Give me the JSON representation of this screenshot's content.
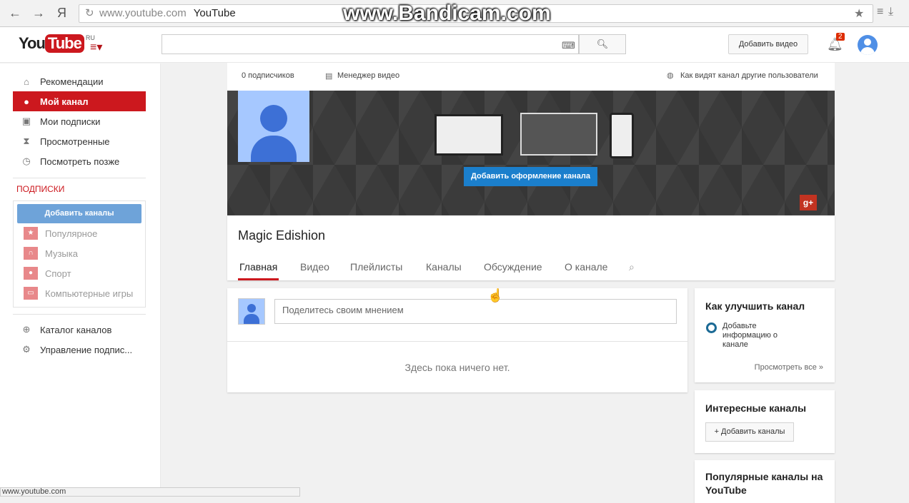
{
  "browser": {
    "back": "←",
    "forward": "→",
    "yandex": "Я",
    "url_host": "www.youtube.com",
    "url_title": "YouTube",
    "star": "★",
    "watermark": "www.Bandicam.com",
    "status": "www.youtube.com"
  },
  "header": {
    "logo_you": "You",
    "logo_tube": "Tube",
    "logo_region": "RU",
    "upload": "Добавить видео",
    "notifications": "2"
  },
  "sidebar": {
    "items": [
      {
        "label": "Рекомендации",
        "icon": "home-icon"
      },
      {
        "label": "Мой канал",
        "icon": "user-icon"
      },
      {
        "label": "Мои подписки",
        "icon": "subscriptions-icon"
      },
      {
        "label": "Просмотренные",
        "icon": "hourglass-icon"
      },
      {
        "label": "Посмотреть позже",
        "icon": "clock-icon"
      }
    ],
    "subs_heading": "ПОДПИСКИ",
    "add_channels": "Добавить каналы",
    "subs": [
      {
        "label": "Популярное"
      },
      {
        "label": "Музыка"
      },
      {
        "label": "Спорт"
      },
      {
        "label": "Компьютерные игры"
      }
    ],
    "bottom": [
      {
        "label": "Каталог каналов"
      },
      {
        "label": "Управление подпис..."
      }
    ]
  },
  "channel": {
    "subscribers": "0 подписчиков",
    "video_manager": "Менеджер видео",
    "view_as": "Как видят канал другие пользователи",
    "add_art": "Добавить оформление канала",
    "gplus": "g+",
    "name": "Magic Edishion",
    "tabs": [
      "Главная",
      "Видео",
      "Плейлисты",
      "Каналы",
      "Обсуждение",
      "О канале"
    ],
    "share_placeholder": "Поделитесь своим мнением",
    "empty": "Здесь пока ничего нет."
  },
  "right": {
    "improve_title": "Как улучшить канал",
    "improve_item": "Добавьте информацию о канале",
    "view_all": "Просмотреть все  »",
    "interesting_title": "Интересные каналы",
    "add_channels": "+ Добавить каналы",
    "popular_title": "Популярные каналы на YouTube"
  }
}
